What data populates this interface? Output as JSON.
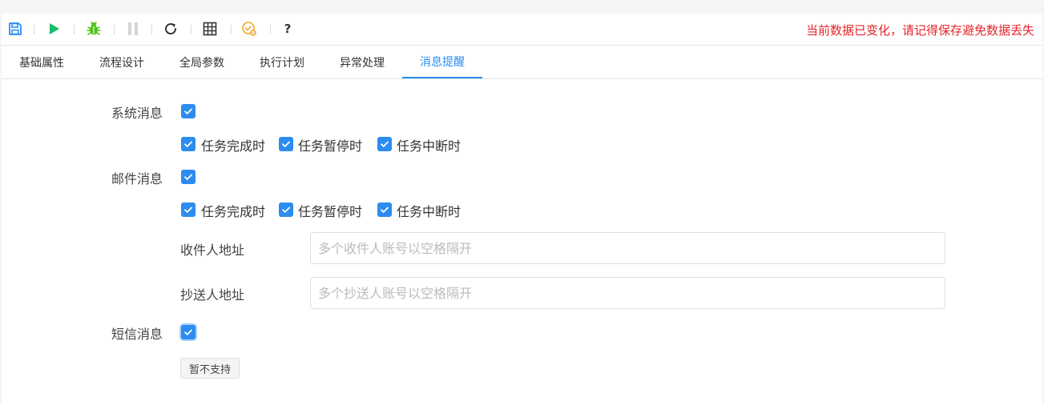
{
  "toolbar": {
    "icons": [
      "save-icon",
      "run-icon",
      "debug-icon",
      "pause-icon",
      "refresh-icon",
      "grid-icon",
      "settings-check-icon",
      "help-icon"
    ],
    "help_label": "?",
    "warning": "当前数据已变化，请记得保存避免数据丢失",
    "colors": {
      "save": "#2d8cf0",
      "run": "#19be6b",
      "debug": "#52c41a",
      "pause_disabled": "#d4d4d4",
      "settings": "#f5a623",
      "warning": "#e6252a"
    }
  },
  "tabs": [
    {
      "label": "基础属性",
      "active": false
    },
    {
      "label": "流程设计",
      "active": false
    },
    {
      "label": "全局参数",
      "active": false
    },
    {
      "label": "执行计划",
      "active": false
    },
    {
      "label": "异常处理",
      "active": false
    },
    {
      "label": "消息提醒",
      "active": true
    }
  ],
  "form": {
    "system_msg": {
      "label": "系统消息",
      "checked": true,
      "options": [
        {
          "label": "任务完成时",
          "checked": true
        },
        {
          "label": "任务暂停时",
          "checked": true
        },
        {
          "label": "任务中断时",
          "checked": true
        }
      ]
    },
    "mail_msg": {
      "label": "邮件消息",
      "checked": true,
      "options": [
        {
          "label": "任务完成时",
          "checked": true
        },
        {
          "label": "任务暂停时",
          "checked": true
        },
        {
          "label": "任务中断时",
          "checked": true
        }
      ],
      "recipient": {
        "label": "收件人地址",
        "value": "",
        "placeholder": "多个收件人账号以空格隔开"
      },
      "cc": {
        "label": "抄送人地址",
        "value": "",
        "placeholder": "多个抄送人账号以空格隔开"
      }
    },
    "sms_msg": {
      "label": "短信消息",
      "checked": true,
      "unsupported_label": "暂不支持"
    }
  },
  "accent_color": "#2d8cf0"
}
